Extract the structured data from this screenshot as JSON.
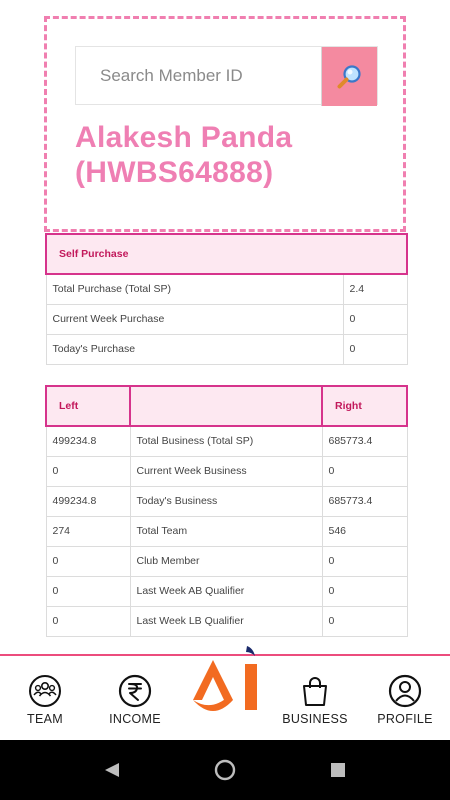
{
  "search": {
    "placeholder": "Search Member ID",
    "icon": "magnifier-icon"
  },
  "member": {
    "name_line1": "Alakesh Panda",
    "name_line2": "(HWBS64888)"
  },
  "self_purchase": {
    "header": "Self Purchase",
    "rows": [
      {
        "label": "Total Purchase (Total SP)",
        "value": "2.4"
      },
      {
        "label": "Current Week Purchase",
        "value": "0"
      },
      {
        "label": "Today's Purchase",
        "value": "0"
      }
    ]
  },
  "business": {
    "headers": {
      "left": "Left",
      "middle": "",
      "right": "Right"
    },
    "rows": [
      {
        "left": "499234.8",
        "label": "Total Business (Total SP)",
        "right": "685773.4"
      },
      {
        "left": "0",
        "label": "Current Week Business",
        "right": "0"
      },
      {
        "left": "499234.8",
        "label": "Today's Business",
        "right": "685773.4"
      },
      {
        "left": "274",
        "label": "Total Team",
        "right": "546"
      },
      {
        "left": "0",
        "label": "Club Member",
        "right": "0"
      },
      {
        "left": "0",
        "label": "Last Week AB Qualifier",
        "right": "0"
      },
      {
        "left": "0",
        "label": "Last Week LB Qualifier",
        "right": "0"
      }
    ]
  },
  "nav": {
    "team": "TEAM",
    "income": "INCOME",
    "business": "BUSINESS",
    "profile": "PROFILE"
  },
  "colors": {
    "accent": "#ef7fb3",
    "header_bg": "#fde8f1",
    "header_border": "#d6338c",
    "logo_orange": "#f26b21",
    "logo_navy": "#1b2a6b"
  }
}
